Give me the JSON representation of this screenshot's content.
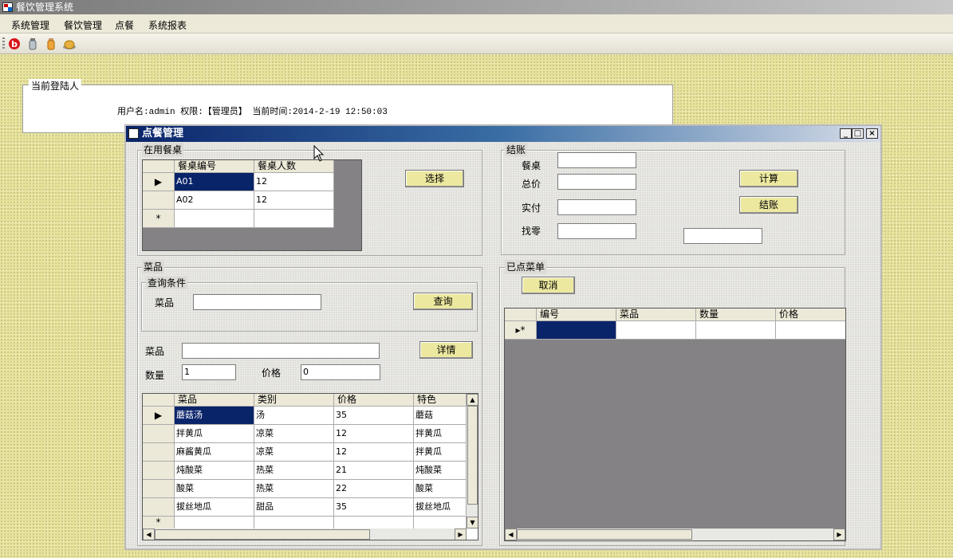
{
  "app": {
    "title": "餐饮管理系统"
  },
  "menu": [
    "系统管理",
    "餐饮管理",
    "点餐",
    "系统报表"
  ],
  "toolbar_icons": [
    "red-b-icon",
    "bottle-icon",
    "jar-icon",
    "food-dish-icon"
  ],
  "login": {
    "legend": "当前登陆人",
    "text": "用户名:admin 权限:【管理员】 当前时间:2014-2-19 12:50:03"
  },
  "order_window": {
    "title": "点餐管理",
    "controls": {
      "minimize": "_",
      "maximize": "□",
      "close": "×"
    },
    "tables_group": {
      "legend": "在用餐桌",
      "select_button": "选择",
      "columns": [
        "餐桌编号",
        "餐桌人数"
      ],
      "rows": [
        [
          "A01",
          "12"
        ],
        [
          "A02",
          "12"
        ]
      ],
      "new_row_marker": "*",
      "current_marker": "▶"
    },
    "checkout": {
      "legend": "结账",
      "table_label": "餐桌",
      "total_label": "总价",
      "paid_label": "实付",
      "change_label": "找零",
      "table_value": "",
      "total_value": "",
      "paid_value": "",
      "change_value": "",
      "extra_value": "",
      "calc_button": "计算",
      "checkout_button": "结账"
    },
    "dishes": {
      "legend": "菜品",
      "query_legend": "查询条件",
      "query_label": "菜品",
      "query_value": "",
      "query_button": "查询",
      "dish_label": "菜品",
      "dish_value": "",
      "detail_button": "详情",
      "qty_label": "数量",
      "qty_value": "1",
      "price_label": "价格",
      "price_value": "0",
      "columns": [
        "菜品",
        "类别",
        "价格",
        "特色"
      ],
      "rows": [
        [
          "蘑菇汤",
          "汤",
          "35",
          "蘑菇"
        ],
        [
          "拌黄瓜",
          "凉菜",
          "12",
          "拌黄瓜"
        ],
        [
          "麻酱黄瓜",
          "凉菜",
          "12",
          "拌黄瓜"
        ],
        [
          "炖酸菜",
          "热菜",
          "21",
          "炖酸菜"
        ],
        [
          "酸菜",
          "热菜",
          "22",
          "酸菜"
        ],
        [
          "拔丝地瓜",
          "甜品",
          "35",
          "拔丝地瓜"
        ]
      ]
    },
    "ordered": {
      "legend": "已点菜单",
      "cancel_button": "取消",
      "columns": [
        "编号",
        "菜品",
        "数量",
        "价格"
      ],
      "row_marker": "▸*"
    }
  }
}
